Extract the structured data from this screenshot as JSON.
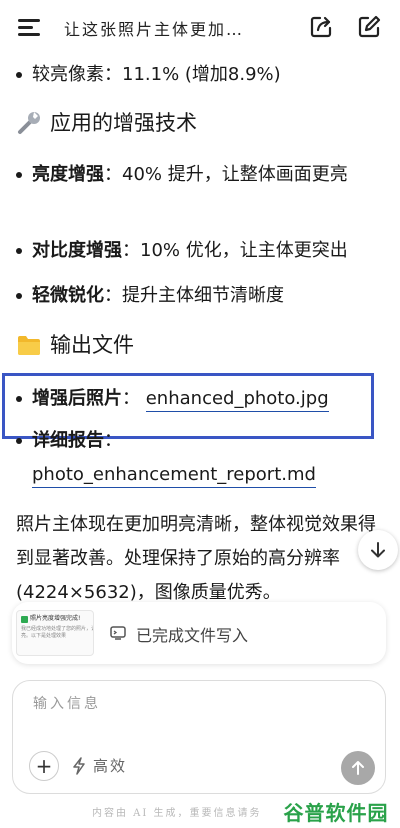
{
  "header": {
    "title": "让这张照片主体更加…"
  },
  "content": {
    "bright_pixels": {
      "label": "较亮像素",
      "value": "：11.1% (增加8.9%)"
    },
    "section_tech": {
      "title": "应用的增强技术"
    },
    "techniques": [
      {
        "name": "亮度增强",
        "desc": "：40% 提升，让整体画面更亮"
      },
      {
        "name": "对比度增强",
        "desc": "：10% 优化，让主体更突出"
      },
      {
        "name": "轻微锐化",
        "desc": "：提升主体细节清晰度"
      }
    ],
    "section_output": {
      "title": "输出文件"
    },
    "output_files": [
      {
        "name": "增强后照片",
        "sep": "：",
        "file": "enhanced_photo.jpg"
      },
      {
        "name": "详细报告",
        "sep": "：",
        "file": "photo_enhancement_report.md"
      }
    ],
    "summary": "照片主体现在更加明亮清晰，整体视觉效果得到显著改善。处理保持了原始的高分辨率(4224×5632)，图像质量优秀。"
  },
  "status_card": {
    "thumb_title": "照片亮度增强完成!",
    "thumb_line1": "我已经成功地处理了您的照片，让主体更",
    "thumb_line2": "亮。以下是处理效果",
    "text": "已完成文件写入"
  },
  "composer": {
    "placeholder": "输入信息",
    "mode_label": "高效"
  },
  "footer": {
    "note": "内容由 AI 生成，重要信息请务",
    "watermark": "谷普软件园"
  },
  "colors": {
    "highlight_border": "#3a56c4",
    "link_underline": "#1f4ea8",
    "watermark": "#2aa24a"
  }
}
